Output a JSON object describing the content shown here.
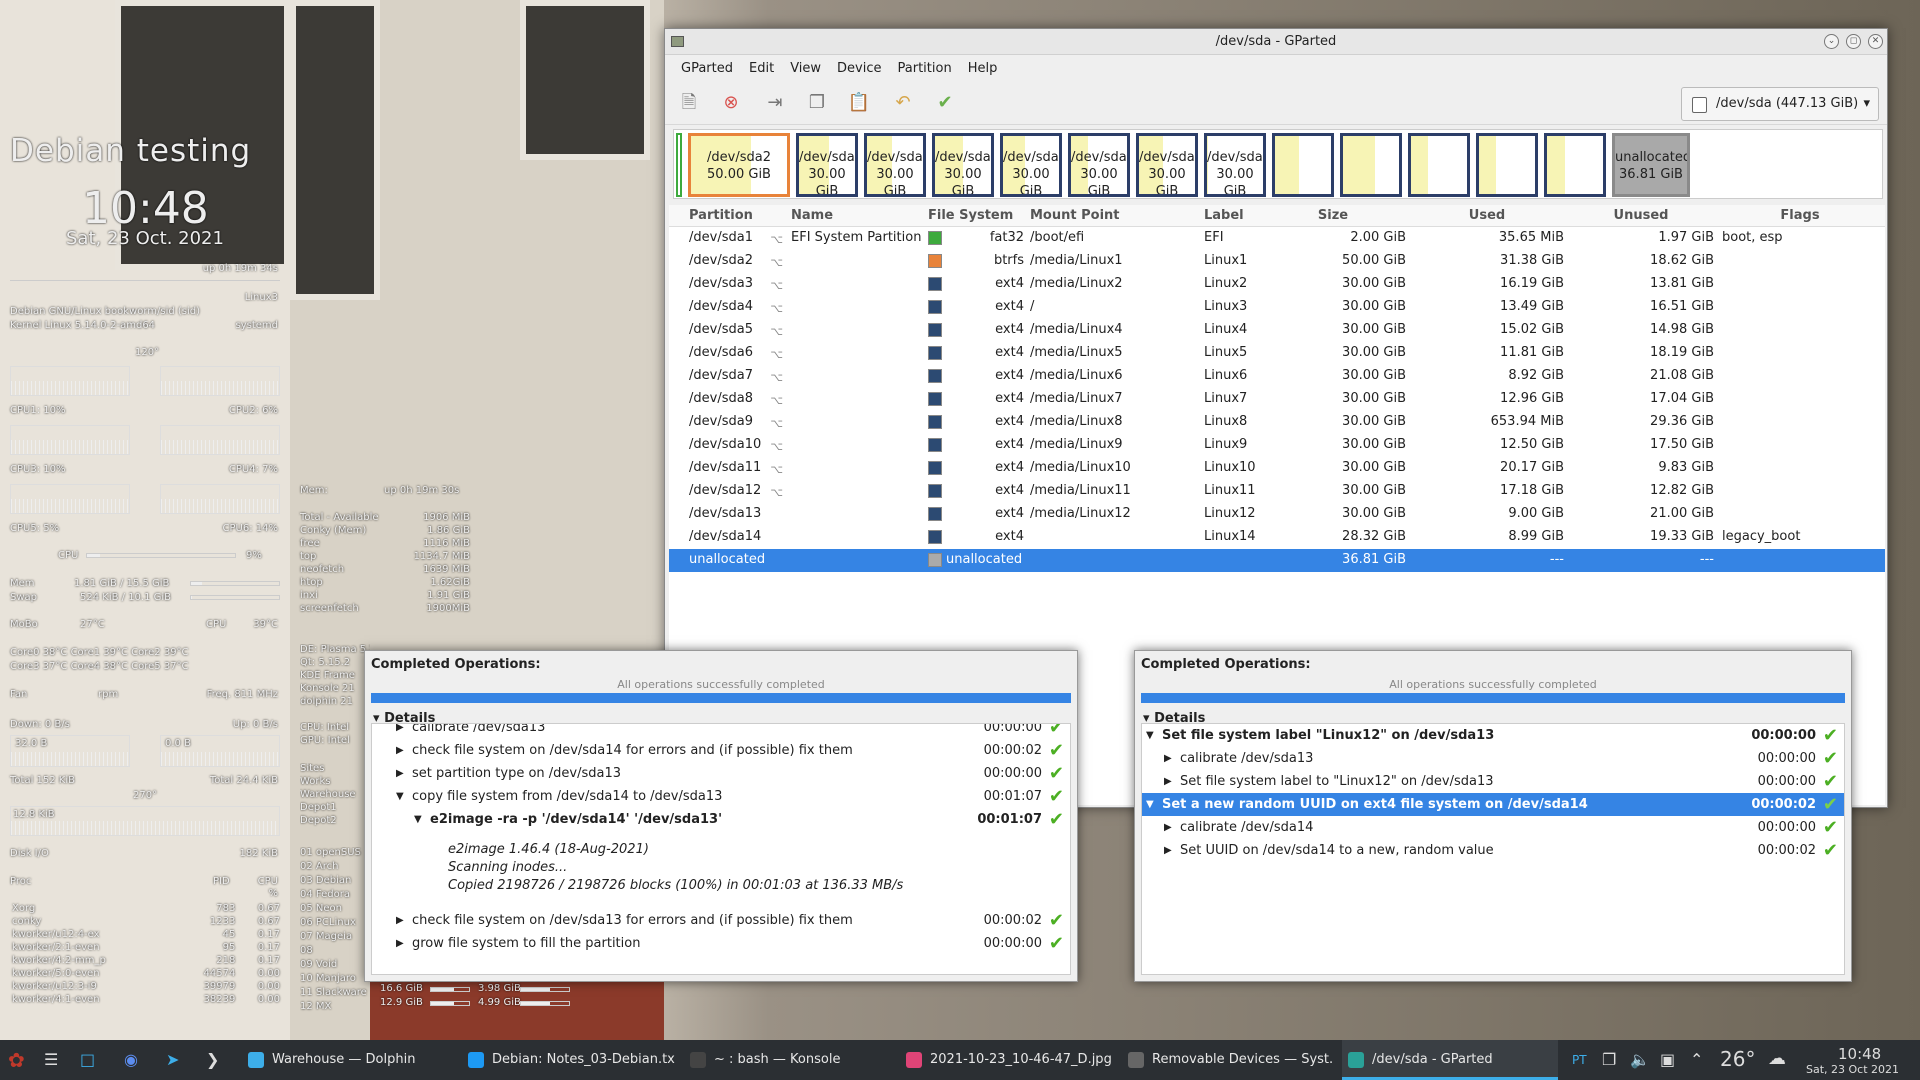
{
  "conky": {
    "title": "Debian testing",
    "time": "10:48",
    "date": "Sat, 23 Oct. 2021",
    "uptime": "up  0h 19m 34s",
    "host": "Linux3",
    "os": "Debian GNU/Linux bookworm/sid (sid)",
    "kernel": "Kernel Linux 5.14.0-2-amd64",
    "init": "systemd",
    "deg120": "120°",
    "cpu1": "CPU1: 10%",
    "cpu2": "CPU2: 6%",
    "cpu3": "CPU3: 10%",
    "cpu4": "CPU4: 7%",
    "cpu5": "CPU5: 5%",
    "cpu6": "CPU6: 14%",
    "cpu_label": "CPU",
    "cpu_pct": "9%",
    "cpu_level": 0.09,
    "mem_label": "Mem",
    "mem_val": "1.81 GiB / 15.5 GiB",
    "mem_level": 0.12,
    "swap_label": "Swap",
    "swap_val": "524 KiB / 10.1 GiB",
    "swap_level": 0.01,
    "mobo_label": "MoBo",
    "mobo_val": "27°C",
    "cpu_t_label": "CPU",
    "cpu_t_val": "39°C",
    "cores_row1": "Core0   38°C     Core1   39°C     Core2   39°C",
    "cores_row2": "Core3   37°C     Core4   38°C     Core5   37°C",
    "fan": "Fan",
    "rpm": "rpm",
    "freq": "Freq.  811   MHz",
    "down": "Down: 0 B/s",
    "up": "Up: 0 B/s",
    "down_box": "32.0 B",
    "up_box": "0.0 B",
    "total_down": "Total 152 KiB",
    "total_up": "Total 24.4 KiB",
    "deg270": "270°",
    "net_small": "12.8 KiB",
    "disk_io": "Disk I/O",
    "disk_val": "182 KiB",
    "proc_head": [
      "Proc",
      "PID",
      "CPU"
    ],
    "proc_pct": "%",
    "procs": [
      [
        "Xorg",
        "783",
        "0.67"
      ],
      [
        "conky",
        "1233",
        "0.67"
      ],
      [
        "kworker/u12:4-ex",
        "45",
        "0.17"
      ],
      [
        "kworker/2:1-even",
        "95",
        "0.17"
      ],
      [
        "kworker/4:2-mm_p",
        "218",
        "0.17"
      ],
      [
        "kworker/5:0-even",
        "44574",
        "0.00"
      ],
      [
        "kworker/u12:3-i9",
        "39979",
        "0.00"
      ],
      [
        "kworker/4:1-even",
        "38239",
        "0.00"
      ]
    ],
    "mem_col": {
      "head": "Mem:",
      "uptime": "up  0h 19m 30s",
      "rows": [
        [
          "Total - Available",
          "1906 MiB"
        ],
        [
          "Conky (Mem)",
          "1.86 GiB"
        ],
        [
          "free",
          "1116   MiB"
        ],
        [
          "top",
          "1134.7  MiB"
        ],
        [
          "neofetch",
          "1639 MiB"
        ],
        [
          "htop",
          "1.62GiB"
        ],
        [
          "inxi",
          "1.91 GiB"
        ],
        [
          "screenfetch",
          "1900MiB"
        ]
      ]
    },
    "de": [
      "DE: Plasma 5.21.5",
      "Qt: 5.15.2",
      "KDE Frame",
      "Konsole 21",
      "dolphin 21"
    ],
    "cpu_gpu": [
      "CPU: Intel",
      "GPU: Intel"
    ],
    "sites": [
      "Sites",
      "Works",
      "Warehouse",
      "Depot1",
      "Depot2"
    ],
    "distros": [
      "01 openSUS",
      "02 Arch",
      "03 Debian",
      "04 Fedora",
      "05 Neon",
      "06 PCLinux",
      "07 Mageia",
      "08",
      "09 Void",
      "10 Manjaro",
      "11 Slackware",
      "12 MX"
    ],
    "distro_sizes": [
      [
        "16.6 GiB",
        "3.98 GiB"
      ],
      [
        "12.9 GiB",
        "4.99 GiB"
      ]
    ]
  },
  "window": {
    "title": "/dev/sda - GParted",
    "menu": [
      "GParted",
      "Edit",
      "View",
      "Device",
      "Partition",
      "Help"
    ],
    "device": "/dev/sda (447.13 GiB)",
    "map": [
      {
        "label": "/dev/sda2",
        "size": "50.00 GiB",
        "used": 0.63
      },
      {
        "label": "/dev/sda3",
        "size": "30.00 GiB",
        "used": 0.54
      },
      {
        "label": "/dev/sda4",
        "size": "30.00 GiB",
        "used": 0.45
      },
      {
        "label": "/dev/sda5",
        "size": "30.00 GiB",
        "used": 0.5
      },
      {
        "label": "/dev/sda6",
        "size": "30.00 GiB",
        "used": 0.39
      },
      {
        "label": "/dev/sda7",
        "size": "30.00 GiB",
        "used": 0.3
      },
      {
        "label": "/dev/sda8",
        "size": "30.00 GiB",
        "used": 0.43
      },
      {
        "label": "/dev/sda9",
        "size": "30.00 GiB",
        "used": 0.02
      },
      {
        "label": "",
        "size": "",
        "used": 0.42
      },
      {
        "label": "",
        "size": "",
        "used": 0.57
      },
      {
        "label": "",
        "size": "",
        "used": 0.3
      },
      {
        "label": "",
        "size": "",
        "used": 0.3
      },
      {
        "label": "",
        "size": "",
        "used": 0.32
      },
      {
        "label": "unallocated",
        "size": "36.81 GiB",
        "used": 0
      }
    ],
    "columns": [
      "Partition",
      "Name",
      "File System",
      "Mount Point",
      "Label",
      "Size",
      "Used",
      "Unused",
      "Flags"
    ],
    "rows": [
      [
        "/dev/sda1",
        "EFI System Partition",
        "fat32",
        "/boot/efi",
        "EFI",
        "2.00 GiB",
        "35.65 MiB",
        "1.97 GiB",
        "boot, esp",
        "#3daa3d"
      ],
      [
        "/dev/sda2",
        "",
        "btrfs",
        "/media/Linux1",
        "Linux1",
        "50.00 GiB",
        "31.38 GiB",
        "18.62 GiB",
        "",
        "#e8833a"
      ],
      [
        "/dev/sda3",
        "",
        "ext4",
        "/media/Linux2",
        "Linux2",
        "30.00 GiB",
        "16.19 GiB",
        "13.81 GiB",
        "",
        "#2c4a72"
      ],
      [
        "/dev/sda4",
        "",
        "ext4",
        "/",
        "Linux3",
        "30.00 GiB",
        "13.49 GiB",
        "16.51 GiB",
        "",
        "#2c4a72"
      ],
      [
        "/dev/sda5",
        "",
        "ext4",
        "/media/Linux4",
        "Linux4",
        "30.00 GiB",
        "15.02 GiB",
        "14.98 GiB",
        "",
        "#2c4a72"
      ],
      [
        "/dev/sda6",
        "",
        "ext4",
        "/media/Linux5",
        "Linux5",
        "30.00 GiB",
        "11.81 GiB",
        "18.19 GiB",
        "",
        "#2c4a72"
      ],
      [
        "/dev/sda7",
        "",
        "ext4",
        "/media/Linux6",
        "Linux6",
        "30.00 GiB",
        "8.92 GiB",
        "21.08 GiB",
        "",
        "#2c4a72"
      ],
      [
        "/dev/sda8",
        "",
        "ext4",
        "/media/Linux7",
        "Linux7",
        "30.00 GiB",
        "12.96 GiB",
        "17.04 GiB",
        "",
        "#2c4a72"
      ],
      [
        "/dev/sda9",
        "",
        "ext4",
        "/media/Linux8",
        "Linux8",
        "30.00 GiB",
        "653.94 MiB",
        "29.36 GiB",
        "",
        "#2c4a72"
      ],
      [
        "/dev/sda10",
        "",
        "ext4",
        "/media/Linux9",
        "Linux9",
        "30.00 GiB",
        "12.50 GiB",
        "17.50 GiB",
        "",
        "#2c4a72"
      ],
      [
        "/dev/sda11",
        "",
        "ext4",
        "/media/Linux10",
        "Linux10",
        "30.00 GiB",
        "20.17 GiB",
        "9.83 GiB",
        "",
        "#2c4a72"
      ],
      [
        "/dev/sda12",
        "",
        "ext4",
        "/media/Linux11",
        "Linux11",
        "30.00 GiB",
        "17.18 GiB",
        "12.82 GiB",
        "",
        "#2c4a72"
      ],
      [
        "/dev/sda13",
        "",
        "ext4",
        "/media/Linux12",
        "Linux12",
        "30.00 GiB",
        "9.00 GiB",
        "21.00 GiB",
        "",
        "#2c4a72"
      ],
      [
        "/dev/sda14",
        "",
        "ext4",
        "",
        "Linux14",
        "28.32 GiB",
        "8.99 GiB",
        "19.33 GiB",
        "legacy_boot",
        "#2c4a72"
      ],
      [
        "unallocated",
        "",
        "unallocated",
        "",
        "",
        "36.81 GiB",
        "---",
        "---",
        "",
        "#aaaaaa"
      ]
    ]
  },
  "dialog_left": {
    "title": "Completed Operations:",
    "note": "All operations successfully completed",
    "details": "Details",
    "ops": [
      {
        "text": "calibrate /dev/sda13",
        "time": "00:00:00",
        "level": 1,
        "arrow": "▶",
        "bold": false
      },
      {
        "text": "check file system on /dev/sda14 for errors and (if possible) fix them",
        "time": "00:00:02",
        "level": 1,
        "arrow": "▶",
        "bold": false
      },
      {
        "text": "set partition type on /dev/sda13",
        "time": "00:00:00",
        "level": 1,
        "arrow": "▶",
        "bold": false
      },
      {
        "text": "copy file system from /dev/sda14 to /dev/sda13",
        "time": "00:01:07",
        "level": 1,
        "arrow": "▼",
        "bold": false
      },
      {
        "text": "e2image -ra -p '/dev/sda14' '/dev/sda13'",
        "time": "00:01:07",
        "level": 2,
        "arrow": "▼",
        "bold": true
      }
    ],
    "output": [
      "e2image 1.46.4 (18-Aug-2021)",
      "Scanning inodes...",
      "Copied 2198726 / 2198726 blocks (100%) in 00:01:03 at 136.33 MB/s"
    ],
    "ops_after": [
      {
        "text": "check file system on /dev/sda13 for errors and (if possible) fix them",
        "time": "00:00:02",
        "level": 1,
        "arrow": "▶",
        "bold": false
      },
      {
        "text": "grow file system to fill the partition",
        "time": "00:00:00",
        "level": 1,
        "arrow": "▶",
        "bold": false
      }
    ]
  },
  "dialog_right": {
    "title": "Completed Operations:",
    "note": "All operations successfully completed",
    "details": "Details",
    "ops": [
      {
        "text": "Set file system label \"Linux12\" on /dev/sda13",
        "time": "00:00:00",
        "level": 0,
        "arrow": "▼",
        "bold": true,
        "sel": false
      },
      {
        "text": "calibrate /dev/sda13",
        "time": "00:00:00",
        "level": 1,
        "arrow": "▶",
        "bold": false,
        "sel": false
      },
      {
        "text": "Set file system label to \"Linux12\" on /dev/sda13",
        "time": "00:00:00",
        "level": 1,
        "arrow": "▶",
        "bold": false,
        "sel": false
      },
      {
        "text": "Set a new random UUID on ext4 file system on /dev/sda14",
        "time": "00:00:02",
        "level": 0,
        "arrow": "▼",
        "bold": true,
        "sel": true
      },
      {
        "text": "calibrate /dev/sda14",
        "time": "00:00:00",
        "level": 1,
        "arrow": "▶",
        "bold": false,
        "sel": false
      },
      {
        "text": "Set UUID on /dev/sda14 to a new, random value",
        "time": "00:00:02",
        "level": 1,
        "arrow": "▶",
        "bold": false,
        "sel": false
      }
    ]
  },
  "taskbar": {
    "tasks": [
      {
        "label": "Warehouse — Dolphin",
        "color": "#3daee9"
      },
      {
        "label": "Debian: Notes_03-Debian.tx...",
        "color": "#1d99f3"
      },
      {
        "label": "~ : bash — Konsole",
        "color": "#444"
      },
      {
        "label": "2021-10-23_10-46-47_D.jpg ...",
        "color": "#e04477"
      },
      {
        "label": "Removable Devices — Syst...",
        "color": "#666"
      },
      {
        "label": "/dev/sda - GParted",
        "color": "#2aa198"
      }
    ],
    "lang": "PT",
    "temp": "26°",
    "time": "10:48",
    "date": "Sat, 23 Oct 2021"
  }
}
